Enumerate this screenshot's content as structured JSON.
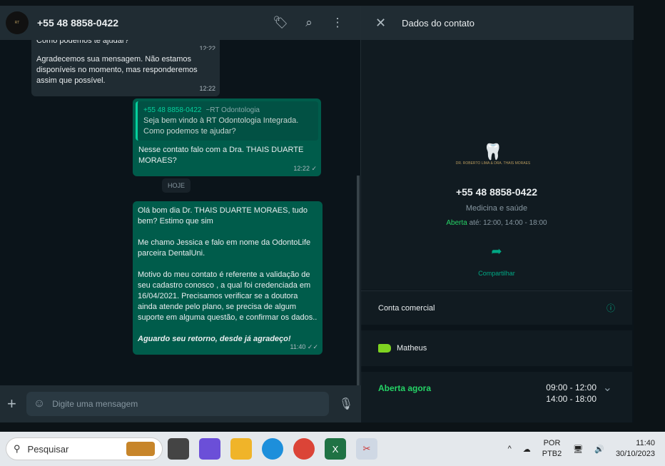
{
  "chat": {
    "contact": "+55 48 8858-0422",
    "avatar_text": "DR. ROBERTO LIMA & DRA. THAIS MORAES",
    "messages": [
      {
        "dir": "in",
        "text": "Como podemos te ajudar?",
        "time": "12:22"
      },
      {
        "dir": "in",
        "text": "Agradecemos sua mensagem. Não estamos disponíveis no momento, mas responderemos assim que possível.",
        "time": "12:22"
      },
      {
        "dir": "out",
        "quote_author": "+55 48 8858-0422",
        "quote_name": "~RT Odontologia",
        "quote_text": "Seja bem vindo à RT Odontologia Integrada. Como podemos te ajudar?",
        "text": "Nesse contato falo com a Dra. THAIS DUARTE MORAES?",
        "time": "12:22"
      },
      {
        "dir": "out",
        "text": "Olá bom dia Dr. THAIS DUARTE MORAES, tudo bem? Estimo que sim\n\nMe chamo Jessica e falo em nome da OdontoLife parceira DentalUni.\n\nMotivo do meu contato é referente a validação de seu cadastro conosco , a qual foi credenciada em 16/04/2021. Precisamos verificar se a doutora ainda atende pelo plano, se precisa de algum suporte em alguma questão, e confirmar os dados..",
        "bold": "Aguardo seu retorno, desde já agradeço!",
        "time": "11:40"
      }
    ],
    "day_label": "HOJE",
    "input_placeholder": "Digite uma mensagem"
  },
  "panel": {
    "title": "Dados do contato",
    "phone": "+55 48 8858-0422",
    "category": "Medicina e saúde",
    "open_label": "Aberta",
    "open_hours": "até: 12:00, 14:00 - 18:00",
    "share": "Compartilhar",
    "business": "Conta comercial",
    "label": "Matheus",
    "label_color": "#7ed321",
    "hours_title": "Aberta agora",
    "hours": [
      "09:00 - 12:00",
      "14:00 - 18:00"
    ],
    "logo_text": "DR. ROBERTO LIMA & DRA. THAIS MORAES"
  },
  "taskbar": {
    "search": "Pesquisar",
    "lang1": "POR",
    "lang2": "PTB2",
    "time": "11:40",
    "date": "30/10/2023"
  }
}
